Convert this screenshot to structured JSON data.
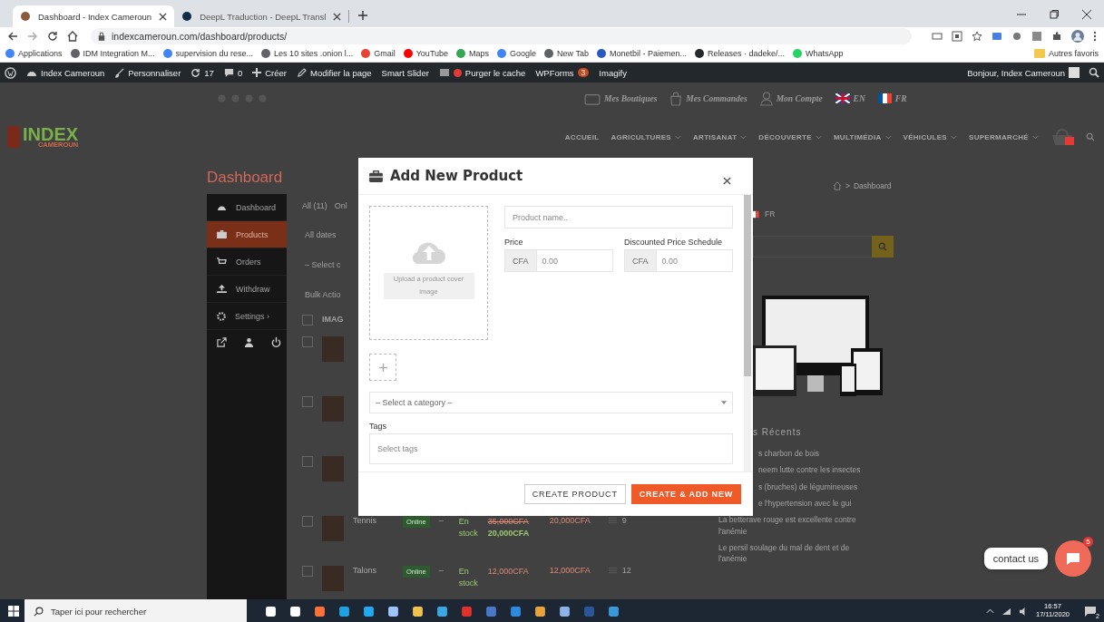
{
  "browser": {
    "tabs": [
      {
        "title": "Dashboard - Index Cameroun",
        "selected": true
      },
      {
        "title": "DeepL Traduction - DeepL Transl",
        "selected": false
      }
    ],
    "url": "indexcameroun.com/dashboard/products/",
    "bookmarks": [
      {
        "label": "Applications",
        "color": "#4285f4"
      },
      {
        "label": "IDM Integration M...",
        "color": "#5f6368"
      },
      {
        "label": "supervision du rese...",
        "color": "#4285f4"
      },
      {
        "label": "Les 10 sites .onion l...",
        "color": "#5f6368"
      },
      {
        "label": "Gmail",
        "color": "#ea4335"
      },
      {
        "label": "YouTube",
        "color": "#ff0000"
      },
      {
        "label": "Maps",
        "color": "#34a853"
      },
      {
        "label": "Google",
        "color": "#4285f4"
      },
      {
        "label": "New Tab",
        "color": "#5f6368"
      },
      {
        "label": "Monetbil - Paiemen...",
        "color": "#2b59c3"
      },
      {
        "label": "Releases · dadeke/...",
        "color": "#24292e"
      },
      {
        "label": "WhatsApp",
        "color": "#25d366"
      }
    ],
    "other_bookmarks": "Autres favoris"
  },
  "admin_bar": {
    "items": [
      {
        "kind": "site",
        "label": "Index Cameroun"
      },
      {
        "kind": "customize",
        "label": "Personnaliser"
      },
      {
        "kind": "updates",
        "label": "17"
      },
      {
        "kind": "comments",
        "label": "0"
      },
      {
        "kind": "new",
        "label": "Créer"
      },
      {
        "kind": "edit",
        "label": "Modifier la page"
      },
      {
        "kind": "plain",
        "label": "Smart Slider"
      },
      {
        "kind": "cache",
        "label": "Purger le cache"
      },
      {
        "kind": "badge",
        "label": "WPForms",
        "badge": "3"
      },
      {
        "kind": "plain",
        "label": "Imagify"
      }
    ],
    "greeting": "Bonjour, Index Cameroun"
  },
  "site": {
    "top_links": [
      {
        "kind": "shop",
        "label": "Mes Boutiques"
      },
      {
        "kind": "orders",
        "label": "Mes Commandes"
      },
      {
        "kind": "account",
        "label": "Mon Compte"
      },
      {
        "kind": "flag_en",
        "label": "EN"
      },
      {
        "kind": "flag_fr",
        "label": "FR"
      }
    ],
    "logo": {
      "name": "INDEX",
      "sub": "CAMEROUN"
    },
    "nav": [
      {
        "label": "ACCUEIL",
        "has_menu": false
      },
      {
        "label": "AGRICULTURES",
        "has_menu": true
      },
      {
        "label": "ARTISANAT",
        "has_menu": true
      },
      {
        "label": "DÉCOUVERTE",
        "has_menu": true
      },
      {
        "label": "MULTIMÉDIA",
        "has_menu": true
      },
      {
        "label": "VÉHICULES",
        "has_menu": true
      },
      {
        "label": "SUPERMARCHÉ",
        "has_menu": true
      }
    ]
  },
  "dashboard": {
    "title": "Dashboard",
    "breadcrumb_separator": ">",
    "breadcrumb": "Dashboard",
    "menu": [
      {
        "label": "Dashboard",
        "kind": "dashboard",
        "selected": false
      },
      {
        "label": "Products",
        "kind": "products",
        "selected": true
      },
      {
        "label": "Orders",
        "kind": "orders",
        "selected": false
      },
      {
        "label": "Withdraw",
        "kind": "withdraw",
        "selected": false
      },
      {
        "label": "Settings ›",
        "kind": "settings",
        "selected": false
      }
    ],
    "filters": [
      "All (11)",
      "Onl"
    ],
    "date_filter": "All dates",
    "category_filter": "– Select c",
    "bulk_actions": "Bulk Actio",
    "column_1": "IMAG",
    "select_all_checked": false,
    "rows": [
      {
        "kind": "covered",
        "checked": false
      },
      {
        "kind": "covered",
        "checked": false
      },
      {
        "kind": "covered",
        "checked": false
      },
      {
        "kind": "full",
        "checked": false,
        "name": "Tennis",
        "status": "Online",
        "column_4": "–",
        "stock": "En stock",
        "price_old": "35,000CFA",
        "price": "20,000CFA",
        "column_7": "20,000CFA",
        "views": "9"
      },
      {
        "kind": "full",
        "checked": false,
        "name": "Talons",
        "status": "Online",
        "column_4": "–",
        "stock": "En stock",
        "price": "12,000CFA",
        "column_7": "12,000CFA",
        "views": "12"
      }
    ]
  },
  "sidebar": {
    "language": "FR",
    "recent_title": "s Récents",
    "recent_partial": [
      "s charbon de bois",
      "neem lutte contre les insectes",
      "s (bruches) de légumineuses",
      "e l'hypertension avec le gui"
    ],
    "recent": [
      "La betterave rouge est excellente contre l'anémie",
      "Le persil soulage du mal de dent et de l'anémie"
    ]
  },
  "modal": {
    "title": "Add New Product",
    "upload_text": "Upload a product cover image",
    "name_placeholder": "Product name..",
    "price": {
      "label": "Price",
      "currency": "CFA",
      "placeholder": "0.00"
    },
    "discount": {
      "label": "Discounted Price Schedule",
      "currency": "CFA",
      "placeholder": "0.00"
    },
    "category": "– Select a category –",
    "tags_label": "Tags",
    "tags_placeholder": "Select tags",
    "buttons": [
      {
        "label": "CREATE PRODUCT",
        "kind": "secondary"
      },
      {
        "label": "CREATE & ADD NEW",
        "kind": "primary"
      }
    ]
  },
  "chat": {
    "label": "contact us",
    "badge": "5"
  },
  "taskbar": {
    "search_placeholder": "Taper ici pour rechercher",
    "time": "16:57",
    "date": "17/11/2020",
    "notifications": "2"
  }
}
